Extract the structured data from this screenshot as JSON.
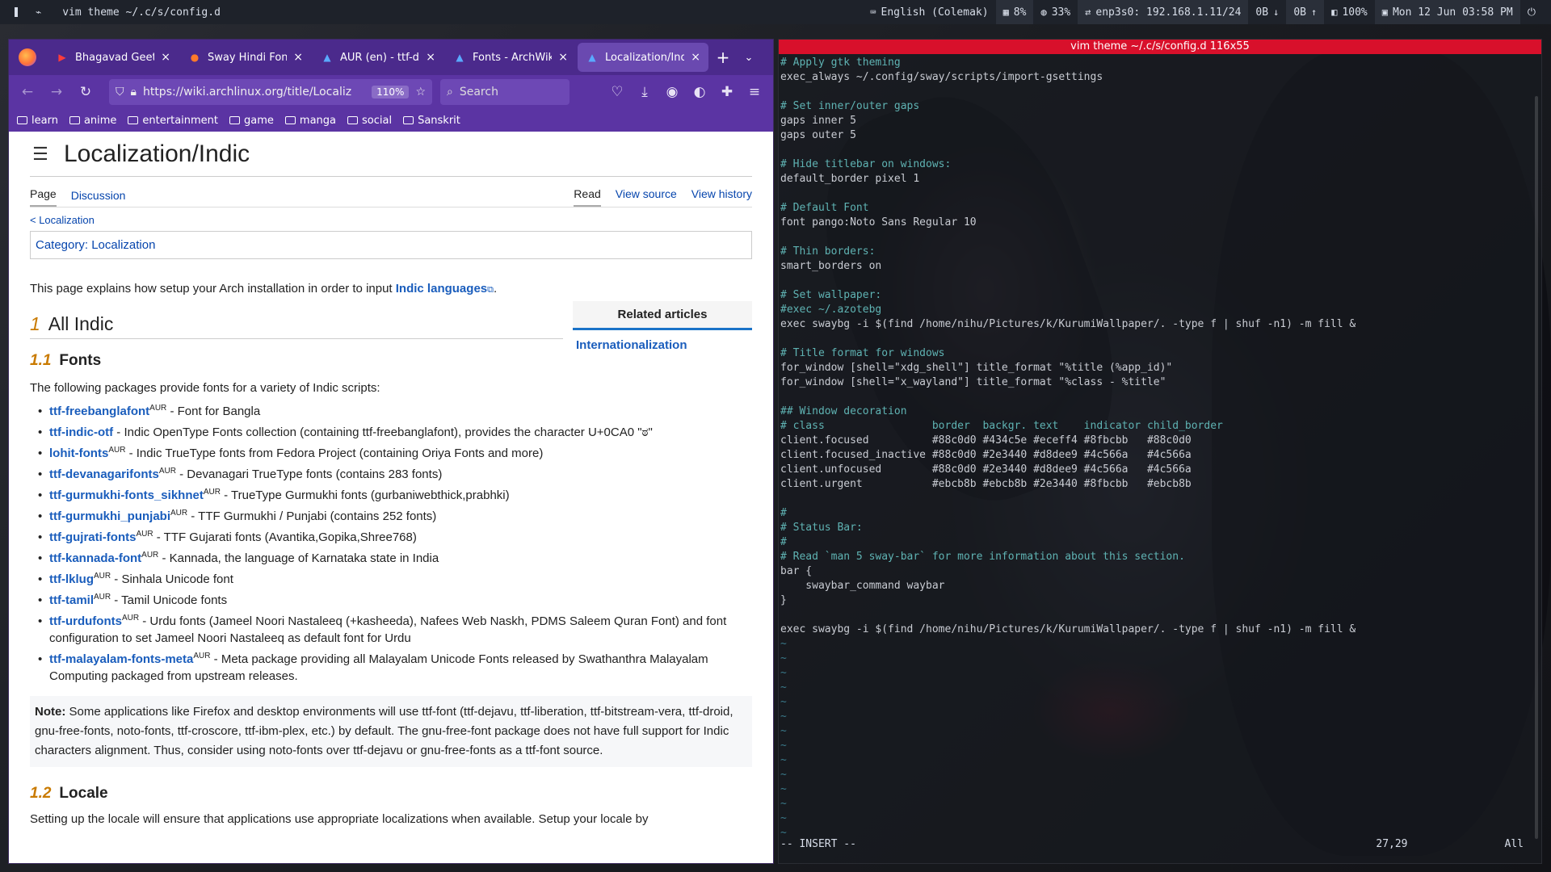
{
  "topbar": {
    "workspace": "1",
    "window_title": "vim theme ~/.c/s/config.d",
    "workspace_icon": "terminal-icon",
    "indicators": [
      {
        "name": "keyboard",
        "icon": "keyboard-icon",
        "text": "English (Colemak)"
      },
      {
        "name": "memory",
        "icon": "memory-icon",
        "text": "8%"
      },
      {
        "name": "cpu",
        "icon": "cpu-icon",
        "text": "33%"
      },
      {
        "name": "network",
        "icon": "network-icon",
        "text": "enp3s0: 192.168.1.11/24"
      },
      {
        "name": "download",
        "icon": "arrow-down-icon",
        "text": "0B"
      },
      {
        "name": "upload",
        "icon": "arrow-up-icon",
        "text": "0B"
      },
      {
        "name": "volume",
        "icon": "volume-icon",
        "text": "100%"
      },
      {
        "name": "clock",
        "icon": "calendar-icon",
        "text": "Mon 12 Jun  03:58 PM"
      }
    ]
  },
  "browser": {
    "tabs": [
      {
        "label": "Bhagavad Geeta",
        "icon": "youtube-icon",
        "active": false
      },
      {
        "label": "Sway Hindi Font",
        "icon": "reddit-icon",
        "active": false
      },
      {
        "label": "AUR (en) - ttf-dev",
        "icon": "archlinux-icon",
        "active": false
      },
      {
        "label": "Fonts - ArchWiki",
        "icon": "archlinux-icon",
        "active": false
      },
      {
        "label": "Localization/Indic",
        "icon": "archlinux-icon",
        "active": true
      }
    ],
    "url": "https://wiki.archlinux.org/title/Localiz",
    "zoom": "110%",
    "search_placeholder": "Search",
    "bookmarks": [
      "learn",
      "anime",
      "entertainment",
      "game",
      "manga",
      "social",
      "Sanskrit"
    ]
  },
  "wiki": {
    "title": "Localization/Indic",
    "tabs_left": [
      "Page",
      "Discussion"
    ],
    "tabs_right": [
      "Read",
      "View source",
      "View history"
    ],
    "breadcrumb": "< Localization",
    "category_label": "Category:",
    "category_value": "Localization",
    "related_title": "Related articles",
    "related_items": [
      "Internationalization"
    ],
    "intro_text": "This page explains how setup your Arch installation in order to input ",
    "intro_link": "Indic languages",
    "intro_end": ".",
    "sec1_num": "1",
    "sec1_title": "All Indic",
    "sec11_num": "1.1",
    "sec11_title": "Fonts",
    "fonts_lead": "The following packages provide fonts for a variety of Indic scripts:",
    "packages": [
      {
        "name": "ttf-freebanglafont",
        "aur": "AUR",
        "desc": " - Font for Bangla"
      },
      {
        "name": "ttf-indic-otf",
        "aur": "",
        "desc": " - Indic OpenType Fonts collection (containing ttf-freebanglafont), provides the character U+0CA0 \"ಠ\""
      },
      {
        "name": "lohit-fonts",
        "aur": "AUR",
        "desc": " - Indic TrueType fonts from Fedora Project (containing Oriya Fonts and more)"
      },
      {
        "name": "ttf-devanagarifonts",
        "aur": "AUR",
        "desc": " - Devanagari TrueType fonts (contains 283 fonts)"
      },
      {
        "name": "ttf-gurmukhi-fonts_sikhnet",
        "aur": "AUR",
        "desc": " - TrueType Gurmukhi fonts (gurbaniwebthick,prabhki)"
      },
      {
        "name": "ttf-gurmukhi_punjabi",
        "aur": "AUR",
        "desc": " - TTF Gurmukhi / Punjabi (contains 252 fonts)"
      },
      {
        "name": "ttf-gujrati-fonts",
        "aur": "AUR",
        "desc": " - TTF Gujarati fonts (Avantika,Gopika,Shree768)"
      },
      {
        "name": "ttf-kannada-font",
        "aur": "AUR",
        "desc": " - Kannada, the language of Karnataka state in India"
      },
      {
        "name": "ttf-lklug",
        "aur": "AUR",
        "desc": " - Sinhala Unicode font"
      },
      {
        "name": "ttf-tamil",
        "aur": "AUR",
        "desc": " - Tamil Unicode fonts"
      },
      {
        "name": "ttf-urdufonts",
        "aur": "AUR",
        "desc": " - Urdu fonts (Jameel Noori Nastaleeq (+kasheeda), Nafees Web Naskh, PDMS Saleem Quran Font) and font configuration to set Jameel Noori Nastaleeq as default font for Urdu"
      },
      {
        "name": "ttf-malayalam-fonts-meta",
        "aur": "AUR",
        "desc": " - Meta package providing all Malayalam Unicode Fonts released by Swathanthra Malayalam Computing packaged from upstream releases."
      }
    ],
    "note_label": "Note:",
    "note_text": " Some applications like Firefox and desktop environments will use ttf-font (ttf-dejavu, ttf-liberation, ttf-bitstream-vera, ttf-droid, gnu-free-fonts, noto-fonts, ttf-croscore, ttf-ibm-plex, etc.) by default. The gnu-free-font package does not have full support for Indic characters alignment. Thus, consider using noto-fonts over ttf-dejavu or gnu-free-fonts as a ttf-font source.",
    "sec12_num": "1.2",
    "sec12_title": "Locale",
    "locale_text": "Setting up the locale will ensure that applications use appropriate localizations when available. Setup your locale by"
  },
  "terminal": {
    "title": "vim theme ~/.c/s/config.d 116x55",
    "lines": [
      {
        "t": "# Apply gtk theming",
        "k": "c"
      },
      {
        "t": "exec_always ~/.config/sway/scripts/import-gsettings",
        "k": "n"
      },
      {
        "t": "",
        "k": "n"
      },
      {
        "t": "# Set inner/outer gaps",
        "k": "c"
      },
      {
        "t": "gaps inner 5",
        "k": "n"
      },
      {
        "t": "gaps outer 5",
        "k": "n"
      },
      {
        "t": "",
        "k": "n"
      },
      {
        "t": "# Hide titlebar on windows:",
        "k": "c"
      },
      {
        "t": "default_border pixel 1",
        "k": "n"
      },
      {
        "t": "",
        "k": "n"
      },
      {
        "t": "# Default Font",
        "k": "c"
      },
      {
        "t": "font pango:Noto Sans Regular 10",
        "k": "n"
      },
      {
        "t": "",
        "k": "n"
      },
      {
        "t": "# Thin borders:",
        "k": "c"
      },
      {
        "t": "smart_borders on",
        "k": "n"
      },
      {
        "t": "",
        "k": "n"
      },
      {
        "t": "# Set wallpaper:",
        "k": "c"
      },
      {
        "t": "#exec ~/.azotebg",
        "k": "c"
      },
      {
        "t": "exec swaybg -i $(find /home/nihu/Pictures/k/KurumiWallpaper/. -type f | shuf -n1) -m fill &",
        "k": "n"
      },
      {
        "t": "",
        "k": "n"
      },
      {
        "t": "# Title format for windows",
        "k": "c"
      },
      {
        "t": "for_window [shell=\"xdg_shell\"] title_format \"%title (%app_id)\"",
        "k": "n"
      },
      {
        "t": "for_window [shell=\"x_wayland\"] title_format \"%class - %title\"",
        "k": "n"
      },
      {
        "t": "",
        "k": "n"
      },
      {
        "t": "## Window decoration",
        "k": "c"
      },
      {
        "t": "# class                 border  backgr. text    indicator child_border",
        "k": "c"
      },
      {
        "t": "client.focused          #88c0d0 #434c5e #eceff4 #8fbcbb   #88c0d0",
        "k": "n"
      },
      {
        "t": "client.focused_inactive #88c0d0 #2e3440 #d8dee9 #4c566a   #4c566a",
        "k": "n"
      },
      {
        "t": "client.unfocused        #88c0d0 #2e3440 #d8dee9 #4c566a   #4c566a",
        "k": "n"
      },
      {
        "t": "client.urgent           #ebcb8b #ebcb8b #2e3440 #8fbcbb   #ebcb8b",
        "k": "n"
      },
      {
        "t": "",
        "k": "n"
      },
      {
        "t": "#",
        "k": "c"
      },
      {
        "t": "# Status Bar:",
        "k": "c"
      },
      {
        "t": "#",
        "k": "c"
      },
      {
        "t": "# Read `man 5 sway-bar` for more information about this section.",
        "k": "c"
      },
      {
        "t": "bar {",
        "k": "n"
      },
      {
        "t": "    swaybar_command waybar",
        "k": "n"
      },
      {
        "t": "}",
        "k": "n"
      },
      {
        "t": "",
        "k": "n"
      },
      {
        "t": "exec swaybg -i $(find /home/nihu/Pictures/k/KurumiWallpaper/. -type f | shuf -n1) -m fill &",
        "k": "n"
      },
      {
        "t": "~",
        "k": "t"
      },
      {
        "t": "~",
        "k": "t"
      },
      {
        "t": "~",
        "k": "t"
      },
      {
        "t": "~",
        "k": "t"
      },
      {
        "t": "~",
        "k": "t"
      },
      {
        "t": "~",
        "k": "t"
      },
      {
        "t": "~",
        "k": "t"
      },
      {
        "t": "~",
        "k": "t"
      },
      {
        "t": "~",
        "k": "t"
      },
      {
        "t": "~",
        "k": "t"
      },
      {
        "t": "~",
        "k": "t"
      },
      {
        "t": "~",
        "k": "t"
      },
      {
        "t": "~",
        "k": "t"
      },
      {
        "t": "~",
        "k": "t"
      }
    ],
    "mode": "-- INSERT --",
    "position": "27,29",
    "scroll": "All"
  },
  "colors": {
    "accent": "#88c0d0",
    "firefox_purple": "#5b34a3",
    "terminal_title": "#d8102b",
    "wiki_link": "#1a5dbc"
  }
}
